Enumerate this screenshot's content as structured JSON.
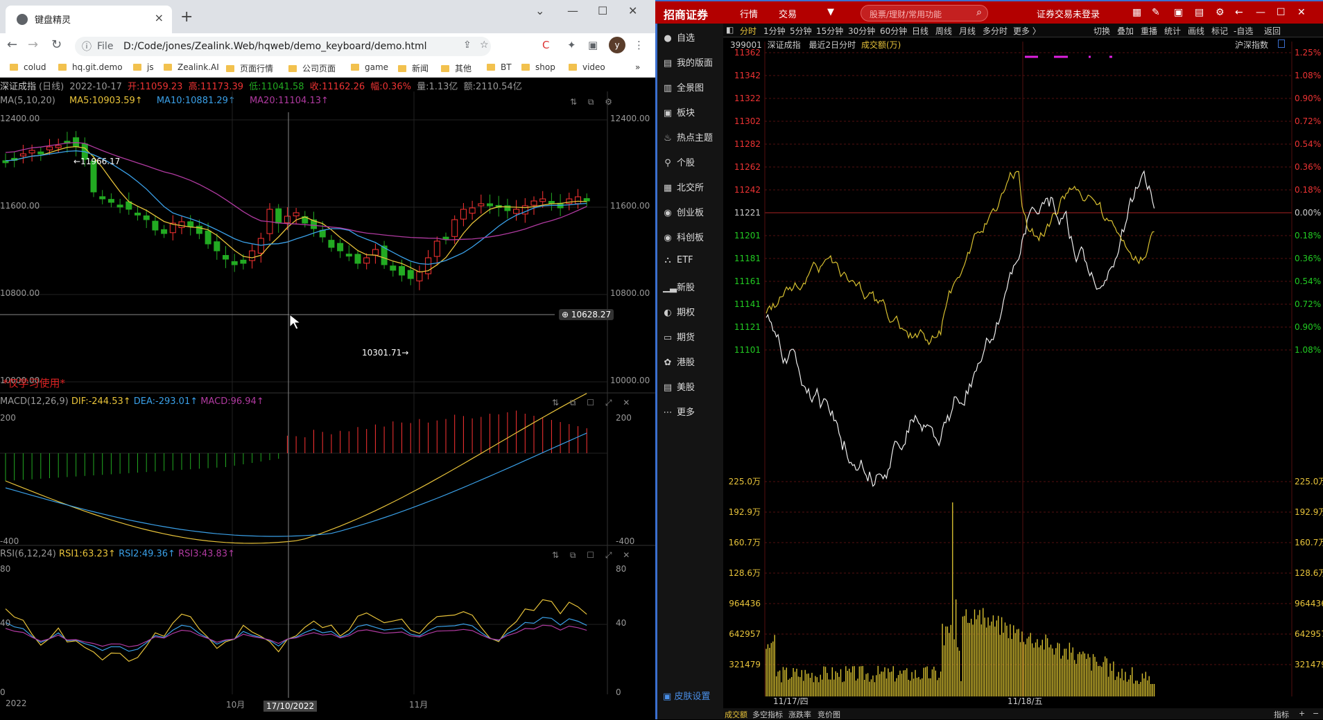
{
  "browser": {
    "tab_title": "键盘精灵",
    "url_scheme": "File",
    "url": "D:/Code/jones/Zealink.Web/hqweb/demo_keyboard/demo.html",
    "profile_initial": "y",
    "bookmarks": [
      "colud",
      "hq.git.demo",
      "js",
      "Zealink.AI",
      "页面行情",
      "公司页面",
      "game",
      "新闻",
      "其他",
      "BT",
      "shop",
      "video"
    ]
  },
  "kline": {
    "info": {
      "name": "深证成指",
      "period": "(日线)",
      "date": "2022-10-17",
      "open": "开:11059.23",
      "high": "高:11173.39",
      "low": "低:11041.58",
      "close": "收:11162.26",
      "change": "幅:0.36%",
      "volume": "量:1.13亿",
      "amount": "额:2110.54亿"
    },
    "ma": {
      "label": "MA(5,10,20)",
      "ma5": "MA5:10903.59↑",
      "ma10": "MA10:10881.29↑",
      "ma20": "MA20:11104.13↑"
    },
    "y_ticks": [
      "12400.00",
      "11600.00",
      "10800.00",
      "10000.00"
    ],
    "max_label": "←11966.17",
    "min_label": "10301.71→",
    "crosshair_price": "10628.27",
    "watermark": "*仅学习使用*",
    "x_labels": [
      "2022",
      "10月",
      "11月"
    ],
    "crosshair_date": "17/10/2022",
    "colors": {
      "up": "#ff3333",
      "down": "#22aa22",
      "ma5": "#e8c33a",
      "ma10": "#3aa0e8",
      "ma20": "#b03aa0"
    }
  },
  "macd": {
    "label": "MACD(12,26,9)",
    "dif": "DIF:-244.53↑",
    "dea": "DEA:-293.01↑",
    "macd": "MACD:96.94↑",
    "y_ticks": [
      "200",
      "-400"
    ]
  },
  "rsi": {
    "label": "RSI(6,12,24)",
    "rsi1": "RSI1:63.23↑",
    "rsi2": "RSI2:49.36↑",
    "rsi3": "RSI3:43.83↑",
    "y_ticks": [
      "80",
      "40",
      "0"
    ]
  },
  "app": {
    "logo": "招商证券",
    "menu": [
      "行情",
      "交易"
    ],
    "search_placeholder": "股票/理财/常用功能",
    "login_status": "证券交易未登录",
    "sidebar": [
      "自选",
      "我的版面",
      "全景图",
      "板块",
      "热点主题",
      "个股",
      "北交所",
      "创业板",
      "科创板",
      "ETF",
      "新股",
      "期权",
      "期货",
      "港股",
      "美股",
      "更多"
    ],
    "skin": "皮肤设置",
    "periods": [
      "分时",
      "1分钟",
      "5分钟",
      "15分钟",
      "30分钟",
      "60分钟",
      "日线",
      "周线",
      "月线",
      "多分时",
      "更多 〉"
    ],
    "tools": [
      "切换",
      "叠加",
      "重播",
      "统计",
      "画线",
      "标记",
      "-自选",
      "返回"
    ],
    "chart_code": "399001",
    "chart_name": "深证成指",
    "chart_range": "最近2日分时",
    "chart_vol_label": "成交额(万)",
    "compare_label": "沪深指数",
    "price_ticks": [
      "11362",
      "11342",
      "11322",
      "11302",
      "11282",
      "11262",
      "11242",
      "11221",
      "11201",
      "11181",
      "11161",
      "11141",
      "11121",
      "11101"
    ],
    "pct_ticks": [
      "1.25%",
      "1.08%",
      "0.90%",
      "0.72%",
      "0.54%",
      "0.36%",
      "0.18%",
      "0.00%",
      "0.18%",
      "0.36%",
      "0.54%",
      "0.72%",
      "0.90%",
      "1.08%"
    ],
    "vol_ticks": [
      "225.0万",
      "192.9万",
      "160.7万",
      "128.6万",
      "964436",
      "642957",
      "321479"
    ],
    "date_labels": [
      "11/17/四",
      "11/18/五"
    ],
    "bottom_tabs": [
      "成交额",
      "多空指标",
      "涨跌率",
      "竞价图"
    ],
    "bottom_right": [
      "指标",
      "+",
      "−"
    ]
  }
}
